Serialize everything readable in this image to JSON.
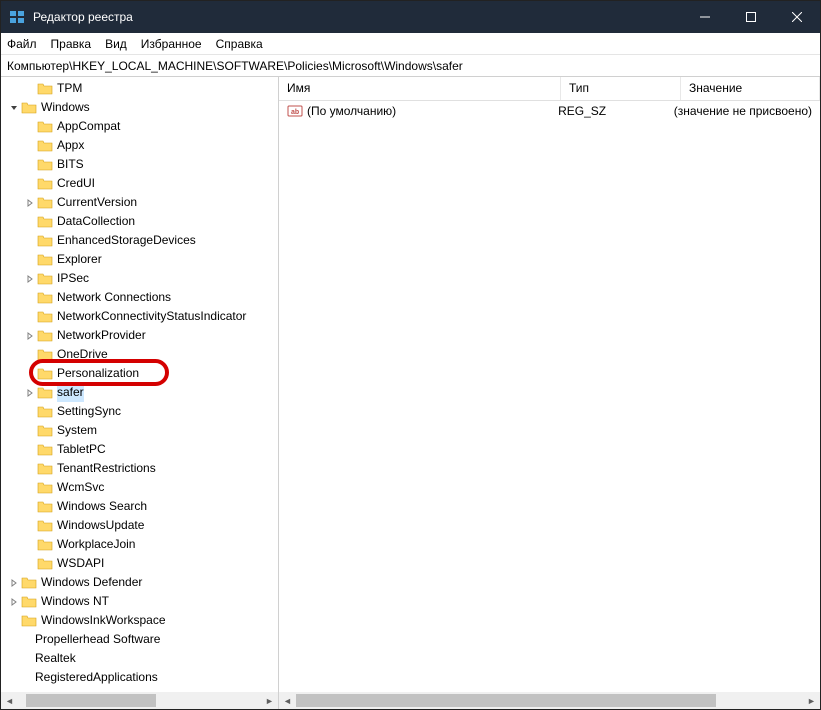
{
  "window": {
    "title": "Редактор реестра"
  },
  "menu": {
    "file": "Файл",
    "edit": "Правка",
    "view": "Вид",
    "favorites": "Избранное",
    "help": "Справка"
  },
  "address": "Компьютер\\HKEY_LOCAL_MACHINE\\SOFTWARE\\Policies\\Microsoft\\Windows\\safer",
  "tree": {
    "items": [
      {
        "indent": 2,
        "expander": "",
        "label": "TPM"
      },
      {
        "indent": 1,
        "expander": "v",
        "label": "Windows"
      },
      {
        "indent": 2,
        "expander": "",
        "label": "AppCompat"
      },
      {
        "indent": 2,
        "expander": "",
        "label": "Appx"
      },
      {
        "indent": 2,
        "expander": "",
        "label": "BITS"
      },
      {
        "indent": 2,
        "expander": "",
        "label": "CredUI"
      },
      {
        "indent": 2,
        "expander": ">",
        "label": "CurrentVersion"
      },
      {
        "indent": 2,
        "expander": "",
        "label": "DataCollection"
      },
      {
        "indent": 2,
        "expander": "",
        "label": "EnhancedStorageDevices"
      },
      {
        "indent": 2,
        "expander": "",
        "label": "Explorer"
      },
      {
        "indent": 2,
        "expander": ">",
        "label": "IPSec"
      },
      {
        "indent": 2,
        "expander": "",
        "label": "Network Connections"
      },
      {
        "indent": 2,
        "expander": "",
        "label": "NetworkConnectivityStatusIndicator"
      },
      {
        "indent": 2,
        "expander": ">",
        "label": "NetworkProvider"
      },
      {
        "indent": 2,
        "expander": "",
        "label": "OneDrive"
      },
      {
        "indent": 2,
        "expander": "",
        "label": "Personalization",
        "highlight": true
      },
      {
        "indent": 2,
        "expander": ">",
        "label": "safer",
        "selected": true
      },
      {
        "indent": 2,
        "expander": "",
        "label": "SettingSync"
      },
      {
        "indent": 2,
        "expander": "",
        "label": "System"
      },
      {
        "indent": 2,
        "expander": "",
        "label": "TabletPC"
      },
      {
        "indent": 2,
        "expander": "",
        "label": "TenantRestrictions"
      },
      {
        "indent": 2,
        "expander": "",
        "label": "WcmSvc"
      },
      {
        "indent": 2,
        "expander": "",
        "label": "Windows Search"
      },
      {
        "indent": 2,
        "expander": "",
        "label": "WindowsUpdate"
      },
      {
        "indent": 2,
        "expander": "",
        "label": "WorkplaceJoin"
      },
      {
        "indent": 2,
        "expander": "",
        "label": "WSDAPI"
      },
      {
        "indent": 1,
        "expander": ">",
        "label": "Windows Defender"
      },
      {
        "indent": 1,
        "expander": ">",
        "label": "Windows NT"
      },
      {
        "indent": 1,
        "expander": "",
        "label": "WindowsInkWorkspace"
      },
      {
        "indent": 0,
        "expander": "",
        "label": "Propellerhead Software",
        "noIcon": true
      },
      {
        "indent": 0,
        "expander": "",
        "label": "Realtek",
        "noIcon": true
      },
      {
        "indent": 0,
        "expander": "",
        "label": "RegisteredApplications",
        "noIcon": true
      }
    ]
  },
  "list": {
    "columns": {
      "name": "Имя",
      "type": "Тип",
      "value": "Значение"
    },
    "rows": [
      {
        "name": "(По умолчанию)",
        "type": "REG_SZ",
        "value": "(значение не присвоено)"
      }
    ]
  }
}
